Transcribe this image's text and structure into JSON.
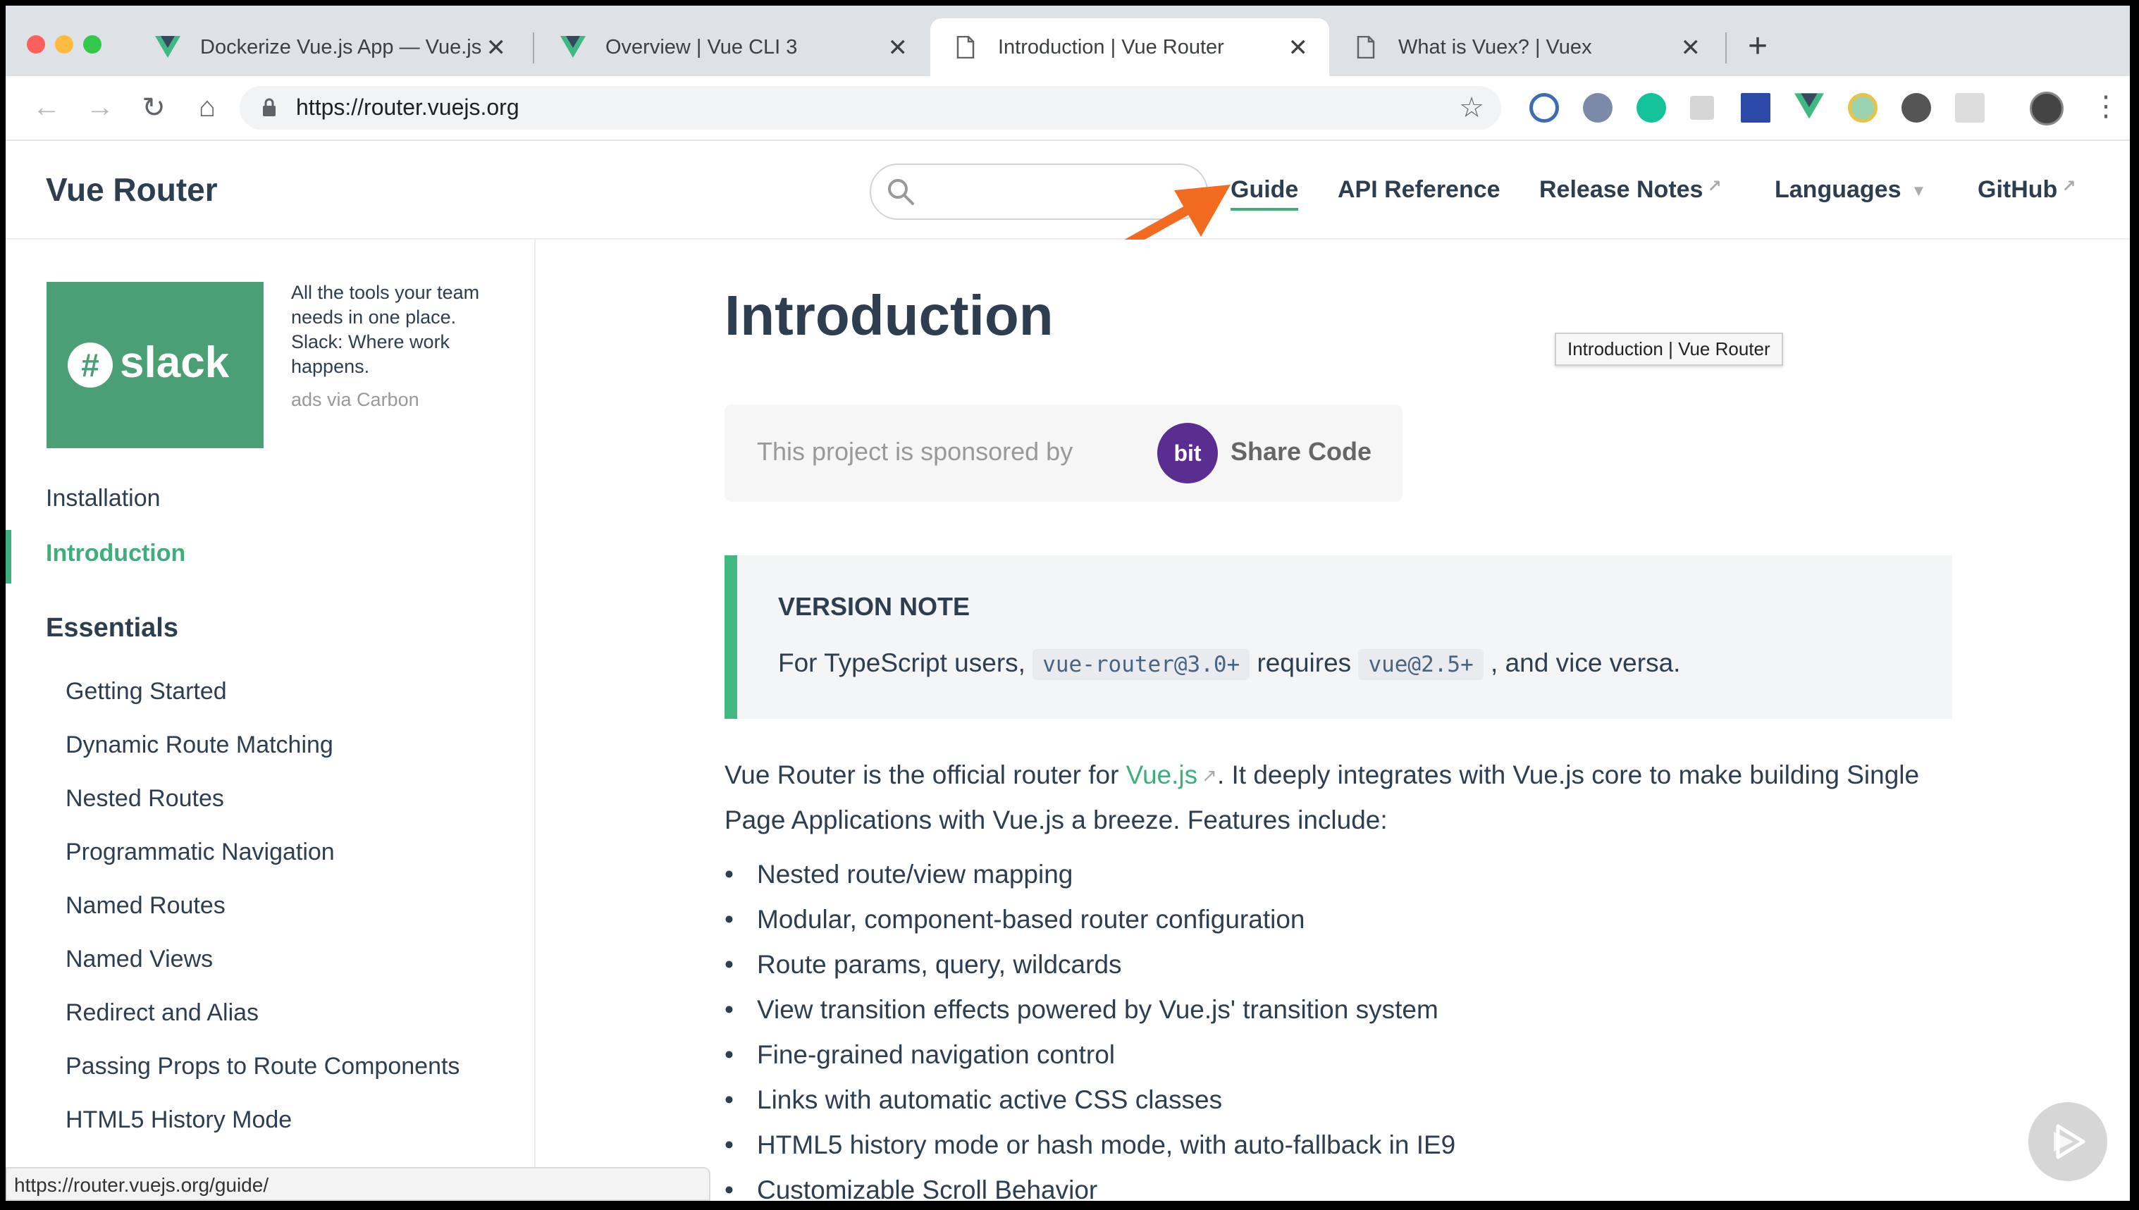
{
  "tabs": [
    {
      "title": "Dockerize Vue.js App — Vue.js",
      "favicon": "vue-icon"
    },
    {
      "title": "Overview | Vue CLI 3",
      "favicon": "vue-icon"
    },
    {
      "title": "Introduction | Vue Router",
      "favicon": "page-icon"
    },
    {
      "title": "What is Vuex? | Vuex",
      "favicon": "page-icon"
    }
  ],
  "url": "https://router.vuejs.org",
  "site": {
    "title": "Vue Router",
    "nav": {
      "guide": "Guide",
      "api": "API Reference",
      "release": "Release Notes",
      "languages": "Languages",
      "github": "GitHub"
    }
  },
  "ad": {
    "brand": "slack",
    "text": "All the tools your team needs in one place. Slack: Where work happens.",
    "via": "ads via Carbon"
  },
  "sidebar": {
    "top": [
      "Installation",
      "Introduction"
    ],
    "heading": "Essentials",
    "items": [
      "Getting Started",
      "Dynamic Route Matching",
      "Nested Routes",
      "Programmatic Navigation",
      "Named Routes",
      "Named Views",
      "Redirect and Alias",
      "Passing Props to Route Components",
      "HTML5 History Mode"
    ]
  },
  "content": {
    "title": "Introduction",
    "tooltip": "Introduction | Vue Router",
    "sponsor_text": "This project is sponsored by",
    "sponsor_logo": "bit",
    "sponsor_name": "Share Code",
    "note_title": "VERSION NOTE",
    "note_pre": "For TypeScript users, ",
    "note_code1": "vue-router@3.0+",
    "note_mid": " requires ",
    "note_code2": "vue@2.5+",
    "note_post": ", and vice versa.",
    "para_pre": "Vue Router is the official router for ",
    "para_link": "Vue.js",
    "para_post": ". It deeply integrates with Vue.js core to make building Single Page Applications with Vue.js a breeze. Features include:",
    "features": [
      "Nested route/view mapping",
      "Modular, component-based router configuration",
      "Route params, query, wildcards",
      "View transition effects powered by Vue.js' transition system",
      "Fine-grained navigation control",
      "Links with automatic active CSS classes",
      "HTML5 history mode or hash mode, with auto-fallback in IE9",
      "Customizable Scroll Behavior"
    ]
  },
  "status_url": "https://router.vuejs.org/guide/",
  "colors": {
    "accent": "#3eaf7c",
    "arrow": "#f26b21",
    "bit": "#5a2d91",
    "slack": "#4a9f75"
  }
}
